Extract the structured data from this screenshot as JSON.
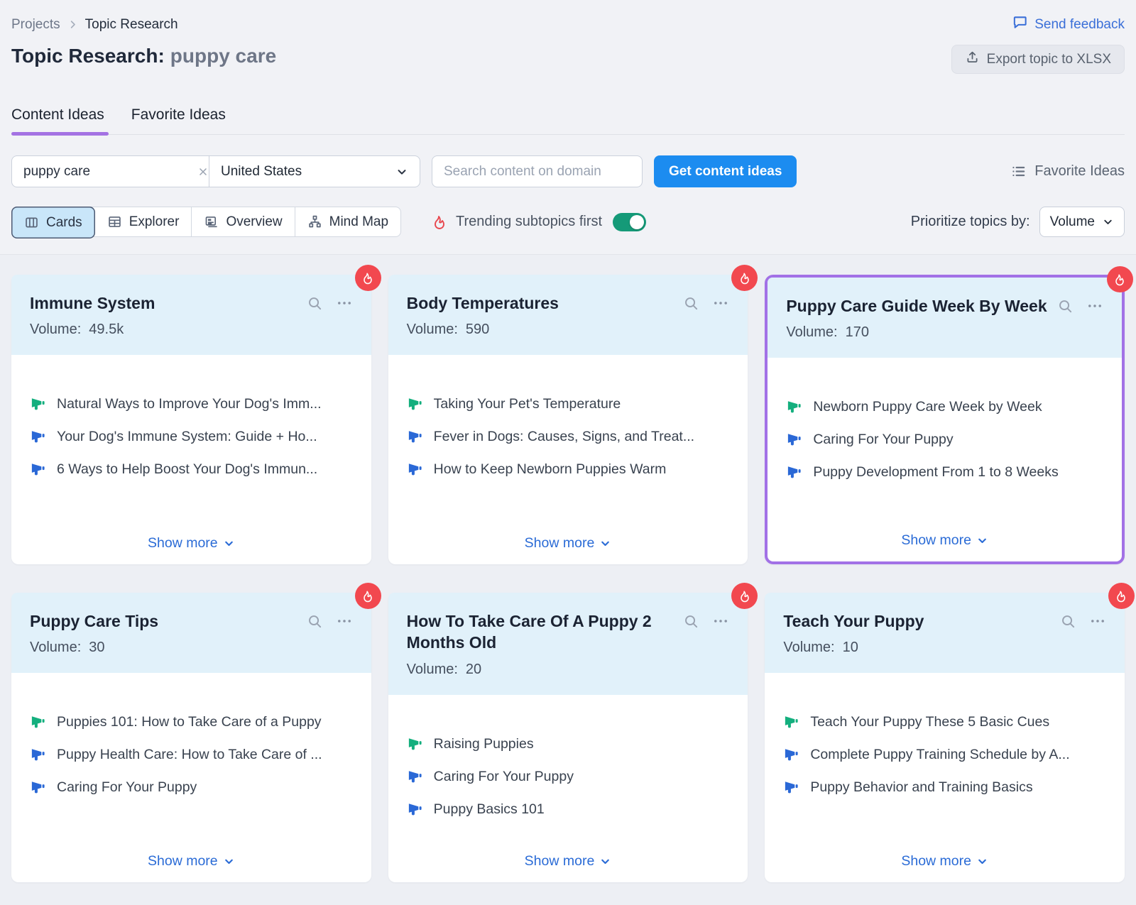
{
  "breadcrumb": {
    "root": "Projects",
    "current": "Topic Research"
  },
  "header": {
    "title_prefix": "Topic Research:",
    "title_query": "puppy care",
    "send_feedback_label": "Send feedback",
    "export_button_label": "Export topic to XLSX"
  },
  "tabs": [
    {
      "label": "Content Ideas",
      "active": true
    },
    {
      "label": "Favorite Ideas",
      "active": false
    }
  ],
  "search": {
    "query": "puppy care",
    "region": "United States",
    "domain_placeholder": "Search content on domain",
    "submit_label": "Get content ideas",
    "favorite_ideas_label": "Favorite Ideas"
  },
  "view_bar": {
    "views": [
      {
        "label": "Cards",
        "icon": "cards-icon",
        "active": true
      },
      {
        "label": "Explorer",
        "icon": "table-icon",
        "active": false
      },
      {
        "label": "Overview",
        "icon": "overview-icon",
        "active": false
      },
      {
        "label": "Mind Map",
        "icon": "mind-map-icon",
        "active": false
      }
    ],
    "trending_label": "Trending subtopics first",
    "trending_on": true,
    "prioritize_label": "Prioritize topics by:",
    "prioritize_value": "Volume"
  },
  "card_labels": {
    "volume_label": "Volume:",
    "show_more": "Show more"
  },
  "cards": [
    {
      "title": "Immune System",
      "volume": "49.5k",
      "trending": true,
      "highlighted": false,
      "ideas": [
        {
          "text": "Natural Ways to Improve Your Dog's Imm...",
          "color": "green"
        },
        {
          "text": "Your Dog's Immune System: Guide + Ho...",
          "color": "blue"
        },
        {
          "text": "6 Ways to Help Boost Your Dog's Immun...",
          "color": "blue"
        }
      ]
    },
    {
      "title": "Body Temperatures",
      "volume": "590",
      "trending": true,
      "highlighted": false,
      "ideas": [
        {
          "text": "Taking Your Pet's Temperature",
          "color": "green"
        },
        {
          "text": "Fever in Dogs: Causes, Signs, and Treat...",
          "color": "blue"
        },
        {
          "text": "How to Keep Newborn Puppies Warm",
          "color": "blue"
        }
      ]
    },
    {
      "title": "Puppy Care Guide Week By Week",
      "volume": "170",
      "trending": true,
      "highlighted": true,
      "ideas": [
        {
          "text": "Newborn Puppy Care Week by Week",
          "color": "green"
        },
        {
          "text": "Caring For Your Puppy",
          "color": "blue"
        },
        {
          "text": "Puppy Development From 1 to 8 Weeks",
          "color": "blue"
        }
      ]
    },
    {
      "title": "Puppy Care Tips",
      "volume": "30",
      "trending": true,
      "highlighted": false,
      "ideas": [
        {
          "text": "Puppies 101: How to Take Care of a Puppy",
          "color": "green"
        },
        {
          "text": "Puppy Health Care: How to Take Care of ...",
          "color": "blue"
        },
        {
          "text": "Caring For Your Puppy",
          "color": "blue"
        }
      ]
    },
    {
      "title": "How To Take Care Of A Puppy 2 Months Old",
      "volume": "20",
      "trending": true,
      "highlighted": false,
      "ideas": [
        {
          "text": "Raising Puppies",
          "color": "green"
        },
        {
          "text": "Caring For Your Puppy",
          "color": "blue"
        },
        {
          "text": "Puppy Basics 101",
          "color": "blue"
        }
      ]
    },
    {
      "title": "Teach Your Puppy",
      "volume": "10",
      "trending": true,
      "highlighted": false,
      "ideas": [
        {
          "text": "Teach Your Puppy These 5 Basic Cues",
          "color": "green"
        },
        {
          "text": "Complete Puppy Training Schedule by A...",
          "color": "blue"
        },
        {
          "text": "Puppy Behavior and Training Basics",
          "color": "blue"
        }
      ]
    }
  ],
  "icons": {
    "breadcrumb_separator": "chevron-right",
    "send_feedback": "speech-bubble",
    "export": "upload-arrow",
    "query_clear": "x-mark",
    "region_dropdown": "chevron-down",
    "favorite_ideas": "bulleted-list",
    "trending": "flame",
    "card_badge": "flame-in-red-circle",
    "card_actions": [
      "magnifier",
      "ellipsis"
    ],
    "idea_bullet": "megaphone",
    "show_more": "chevron-down"
  },
  "colors": {
    "page_bg": "#F1F2F6",
    "cards_section_bg": "#EDEFF4",
    "card_header_bg": "#E1F1FA",
    "tab_underline": "#A472E3",
    "highlight_border": "#A271E6",
    "primary_button": "#1C8CF0",
    "link_blue": "#2A6BD6",
    "feedback_blue": "#3A6FD8",
    "flame_red": "#F2484F",
    "toggle_green": "#159A78",
    "megaphone_green": "#14AF7E",
    "megaphone_blue": "#2A68D6"
  }
}
